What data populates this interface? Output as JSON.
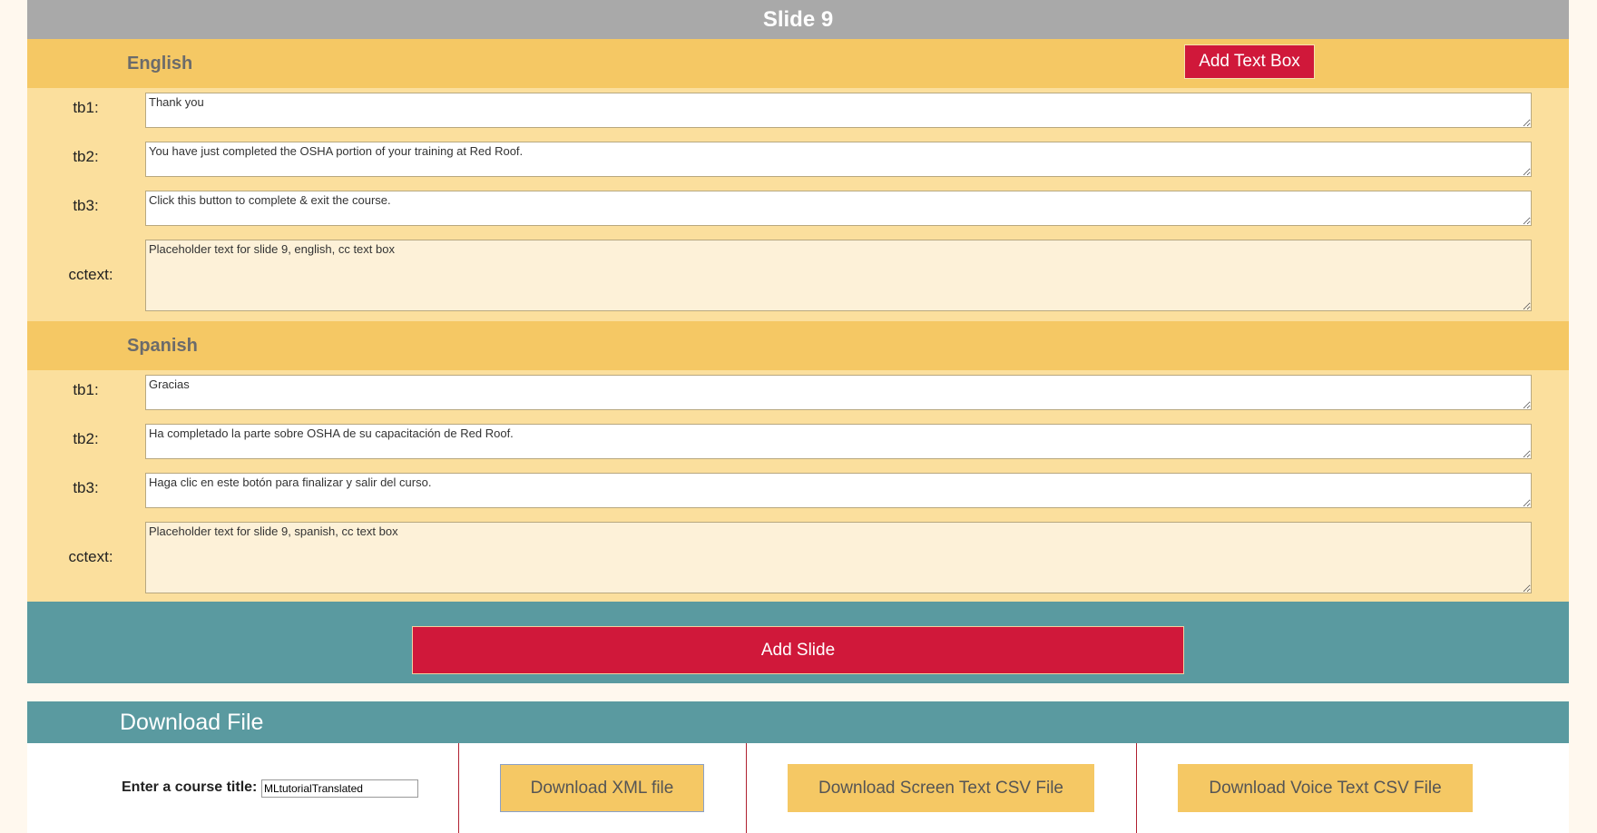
{
  "slide": {
    "title": "Slide 9"
  },
  "english": {
    "heading": "English",
    "add_textbox_label": "Add Text Box",
    "fields": [
      {
        "label": "tb1:",
        "value": "Thank you"
      },
      {
        "label": "tb2:",
        "value": "You have just completed the OSHA portion of your training at Red Roof."
      },
      {
        "label": "tb3:",
        "value": "Click this button to complete & exit the course."
      },
      {
        "label": "cctext:",
        "value": "Placeholder text for slide 9, english, cc text box"
      }
    ]
  },
  "spanish": {
    "heading": "Spanish",
    "fields": [
      {
        "label": "tb1:",
        "value": "Gracias"
      },
      {
        "label": "tb2:",
        "value": "Ha completado la parte sobre OSHA de su capacitación de Red Roof."
      },
      {
        "label": "tb3:",
        "value": "Haga clic en este botón para finalizar y salir del curso."
      },
      {
        "label": "cctext:",
        "value": "Placeholder text for slide 9, spanish, cc text box"
      }
    ]
  },
  "actions": {
    "add_slide_label": "Add Slide"
  },
  "download": {
    "heading": "Download File",
    "course_title_label": "Enter a course title:",
    "course_title_value": "MLtutorialTranslated",
    "xml_button": "Download XML file",
    "screen_csv_button": "Download Screen Text CSV File",
    "voice_csv_button": "Download Voice Text CSV File"
  },
  "colors": {
    "header_gray": "#a9a9a9",
    "section_yellow": "#f5c864",
    "body_yellow": "#fbdf9d",
    "accent_red": "#d0183a",
    "teal": "#5a9aa0"
  }
}
